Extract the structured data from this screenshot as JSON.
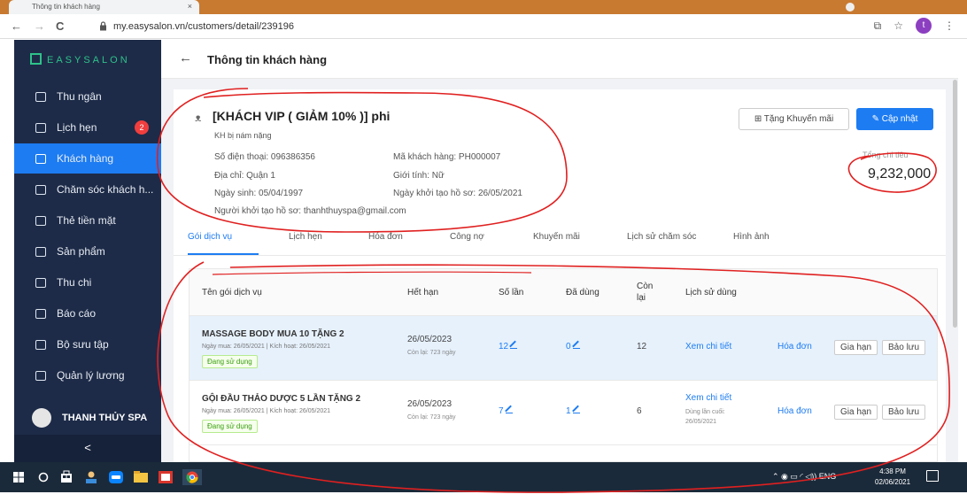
{
  "browser": {
    "tab_title": "Thông tin khách hàng",
    "tab_close": "×",
    "url": "my.easysalon.vn/customers/detail/239196",
    "back": "←",
    "forward": "→",
    "reload": "C",
    "profile_initial": "t",
    "menu": "⋮",
    "star": "☆",
    "cast": "⧉"
  },
  "sidebar": {
    "brand": "EASYSALON",
    "items": [
      {
        "label": "Thu ngân",
        "icon": "cashier-icon"
      },
      {
        "label": "Lịch hẹn",
        "icon": "calendar-icon",
        "badge": "2"
      },
      {
        "label": "Khách hàng",
        "icon": "customers-icon",
        "active": true
      },
      {
        "label": "Chăm sóc khách h...",
        "icon": "customer-care-icon"
      },
      {
        "label": "Thẻ tiền mặt",
        "icon": "cash-card-icon"
      },
      {
        "label": "Sản phẩm",
        "icon": "product-icon"
      },
      {
        "label": "Thu chi",
        "icon": "income-expense-icon"
      },
      {
        "label": "Báo cáo",
        "icon": "report-icon"
      },
      {
        "label": "Bộ sưu tập",
        "icon": "gallery-icon"
      },
      {
        "label": "Quản lý lương",
        "icon": "payroll-icon"
      }
    ],
    "user_name": "THANH THỦY SPA",
    "collapse": "<"
  },
  "header": {
    "back": "←",
    "title": "Thông tin khách hàng"
  },
  "customer": {
    "name": "[KHÁCH VIP ( GIẢM 10% )] phi",
    "note": "KH bị nám nặng",
    "phone": "Số điện thoại: 096386356",
    "code": "Mã khách hàng: PH000007",
    "address": "Địa chỉ: Quận 1",
    "gender": "Giới tính: Nữ",
    "birthday": "Ngày sinh: 05/04/1997",
    "created": "Ngày khởi tạo hồ sơ: 26/05/2021",
    "creator": "Người khởi tạo hồ sơ: thanhthuyspa@gmail.com",
    "promo_button": "Tặng Khuyến mãi",
    "update_button": "Cập nhật",
    "total_label": "Tổng chi tiêu",
    "total_value": "9,232,000"
  },
  "tabs": [
    "Gói dịch vụ",
    "Lịch hẹn",
    "Hóa đơn",
    "Công nợ",
    "Khuyến mãi",
    "Lịch sử chăm sóc",
    "Hình ảnh"
  ],
  "table": {
    "headers": {
      "name": "Tên gói dịch vụ",
      "expiry": "Hết hạn",
      "count": "Số lần",
      "used": "Đã dùng",
      "remaining": "Còn lại",
      "history": "Lịch sử dùng"
    },
    "rows": [
      {
        "name": "MASSAGE BODY MUA 10 TẶNG 2",
        "meta": "Ngày mua: 26/05/2021 | Kích hoạt: 26/05/2021",
        "status": "Đang sử dụng",
        "expiry": "26/05/2023",
        "expiry_left": "Còn lại: 723 ngày",
        "count": "12",
        "used": "0",
        "remaining": "12",
        "history_link": "Xem chi tiết",
        "history_note": "",
        "actions": [
          "Hóa đơn",
          "Gia hạn",
          "Bảo lưu"
        ]
      },
      {
        "name": "GỘI ĐẦU THẢO DƯỢC 5 LẦN TẶNG 2",
        "meta": "Ngày mua: 26/05/2021 | Kích hoạt: 26/05/2021",
        "status": "Đang sử dụng",
        "expiry": "26/05/2023",
        "expiry_left": "Còn lại: 723 ngày",
        "count": "7",
        "used": "1",
        "remaining": "6",
        "history_link": "Xem chi tiết",
        "history_note": "Dùng lần cuối: 26/05/2021",
        "actions": [
          "Hóa đơn",
          "Gia hạn",
          "Bảo lưu"
        ]
      }
    ]
  },
  "taskbar": {
    "tray": "⌃ ◉ ▭ ◜ ◁)) ENG",
    "time": "4:38 PM",
    "date": "02/06/2021"
  },
  "colors": {
    "primary": "#1d7cf2",
    "sidebar": "#1d2b48",
    "brand": "#2ec28a",
    "annotation": "#e02020"
  }
}
